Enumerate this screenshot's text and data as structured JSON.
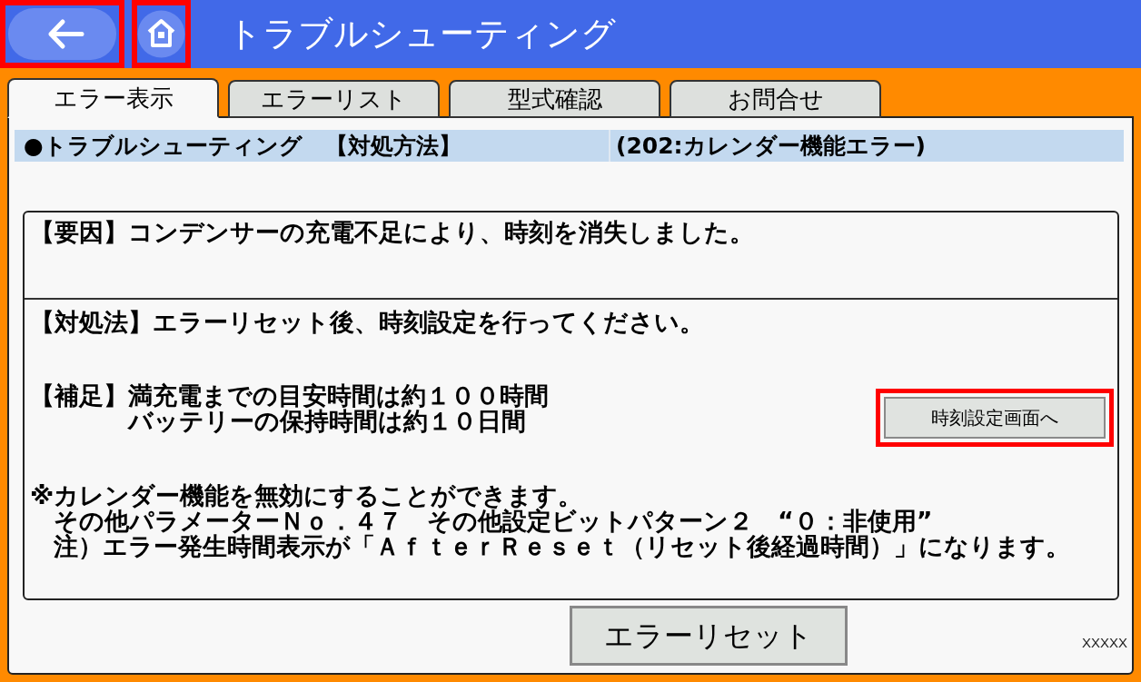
{
  "nav_buttons": [
    {
      "kind": "back",
      "highlighted": true
    },
    {
      "kind": "home",
      "highlighted": true
    }
  ],
  "header": {
    "title": "トラブルシューティング"
  },
  "tabs": [
    {
      "label": "エラー表示",
      "selected": true
    },
    {
      "label": "エラーリスト",
      "selected": false
    },
    {
      "label": "型式確認",
      "selected": false
    },
    {
      "label": "お問合せ",
      "selected": false
    }
  ],
  "title_bar": {
    "heading": "●トラブルシューティング　【対処方法】",
    "error": "(202:カレンダー機能エラー)"
  },
  "cause": "【要因】コンデンサーの充電不足により、時刻を消失しました。",
  "remedy": "【対処法】エラーリセット後、時刻設定を行ってください。",
  "supplement": {
    "label": "【補足】",
    "lines": [
      "満充電までの目安時間は約１００時間",
      "バッテリーの保持時間は約１０日間"
    ]
  },
  "time_setting_button": {
    "label": "時刻設定画面へ",
    "highlighted": true
  },
  "notes": [
    {
      "text": "※カレンダー機能を無効にすることができます。",
      "indented": false
    },
    {
      "text": "その他パラメーターＮｏ．４７　その他設定ビットパターン２　“０：非使用”",
      "indented": true
    },
    {
      "text": "注）エラー発生時間表示が「ＡｆｔｅｒＲｅｓｅｔ（リセット後経過時間）」になります。",
      "indented": true
    }
  ],
  "error_reset_button": {
    "label": "エラーリセット"
  },
  "footer_code": "XXXXX"
}
